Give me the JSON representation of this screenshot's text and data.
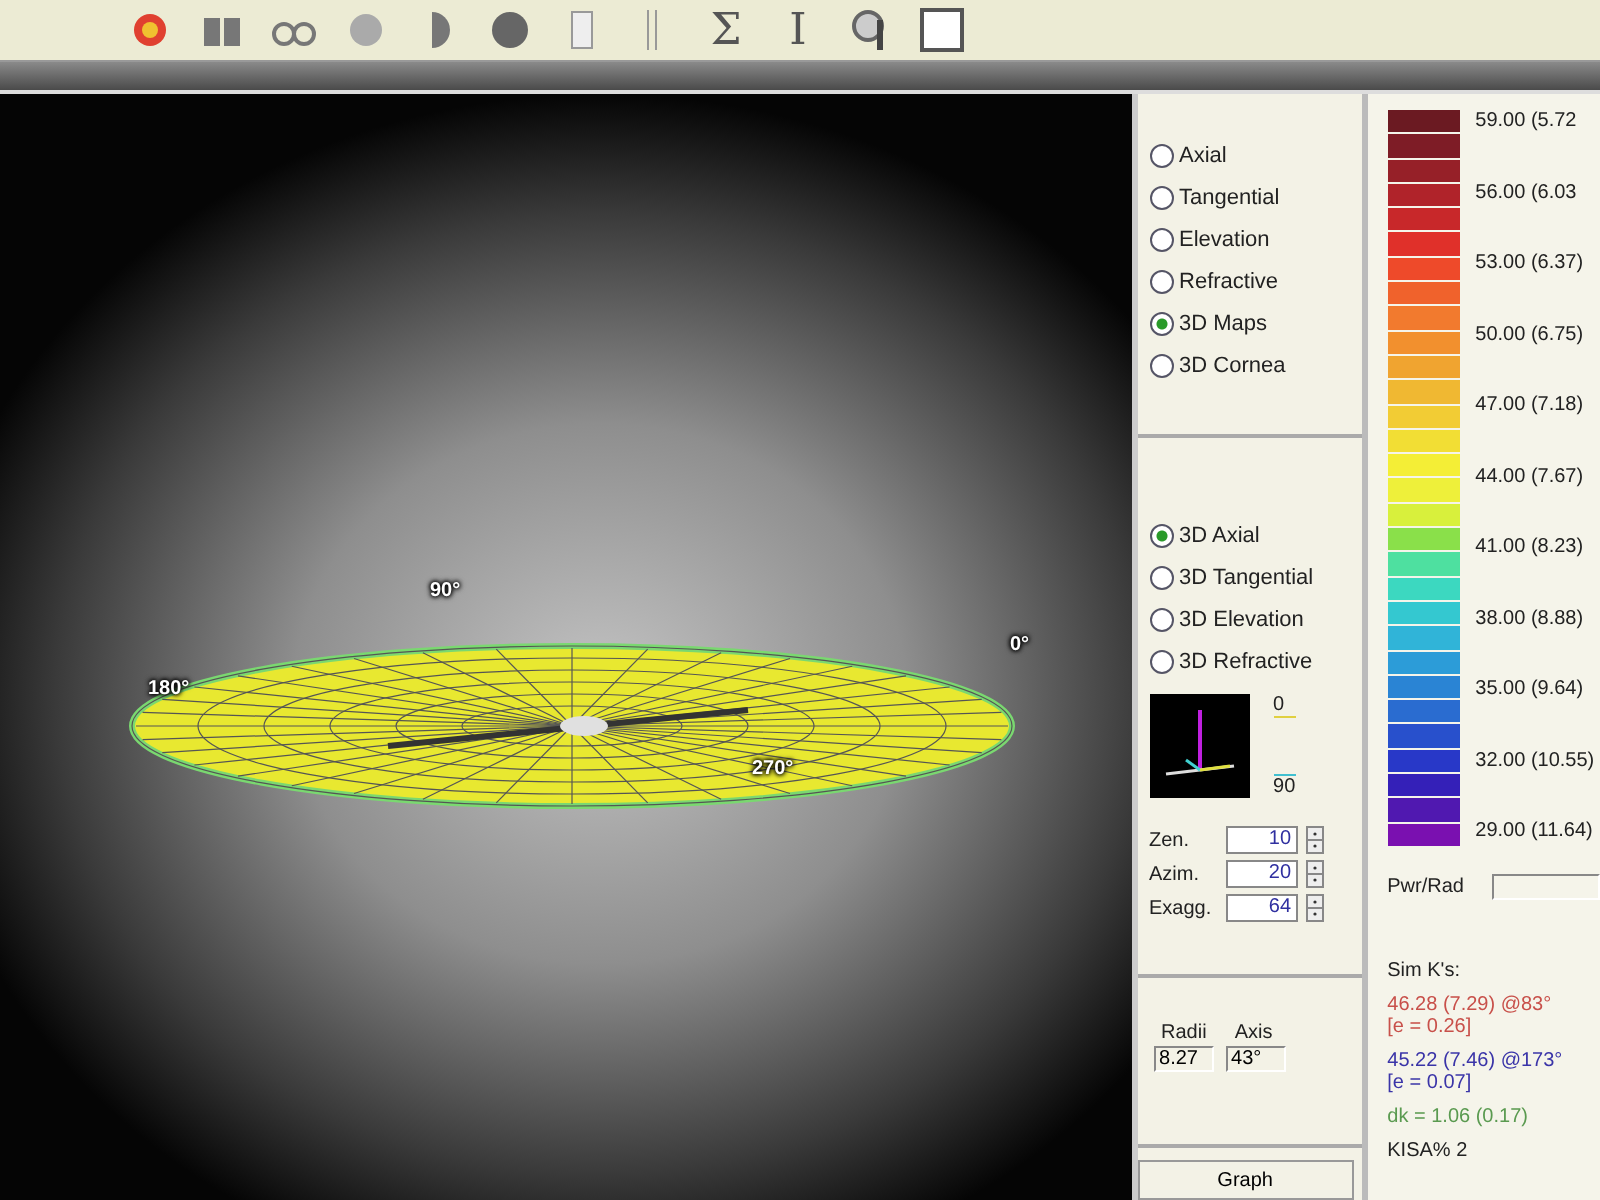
{
  "toolbar": [
    {
      "kind": "heatmap"
    },
    {
      "kind": "bars"
    },
    {
      "kind": "glasses"
    },
    {
      "kind": "sphere"
    },
    {
      "kind": "half-disc"
    },
    {
      "kind": "disc"
    },
    {
      "kind": "page"
    },
    {
      "kind": "lines"
    },
    {
      "kind": "glyph",
      "glyph": "Σ"
    },
    {
      "kind": "glyph",
      "glyph": "I"
    },
    {
      "kind": "magnifier"
    },
    {
      "kind": "window"
    }
  ],
  "viewport": {
    "labels": [
      "90°",
      "180°",
      "0°",
      "270°"
    ]
  },
  "map_types": [
    {
      "label": "Axial",
      "selected": false
    },
    {
      "label": "Tangential",
      "selected": false
    },
    {
      "label": "Elevation",
      "selected": false
    },
    {
      "label": "Refractive",
      "selected": false
    },
    {
      "label": "3D Maps",
      "selected": true
    },
    {
      "label": "3D Cornea",
      "selected": false
    }
  ],
  "map_3d_types": [
    {
      "label": "3D Axial",
      "selected": true
    },
    {
      "label": "3D Tangential",
      "selected": false
    },
    {
      "label": "3D Elevation",
      "selected": false
    },
    {
      "label": "3D Refractive",
      "selected": false
    }
  ],
  "orientation": {
    "top_label": "0",
    "bottom_label": "90"
  },
  "spinners": [
    {
      "label": "Zen.",
      "value": "10"
    },
    {
      "label": "Azim.",
      "value": "20"
    },
    {
      "label": "Exagg.",
      "value": "64"
    }
  ],
  "radii": {
    "radii_label": "Radii",
    "radii_value": "8.27",
    "axis_label": "Axis",
    "axis_value": "43°"
  },
  "graph_button": "Graph",
  "scale": {
    "swatches": [
      {
        "color": "#6b1a22"
      },
      {
        "color": "#7e1c26"
      },
      {
        "color": "#962028"
      },
      {
        "color": "#b0232a"
      },
      {
        "color": "#c8282a"
      },
      {
        "color": "#e0302a"
      },
      {
        "color": "#ee4a2a"
      },
      {
        "color": "#f0622c"
      },
      {
        "color": "#f27a2e"
      },
      {
        "color": "#f2902e"
      },
      {
        "color": "#f0a430"
      },
      {
        "color": "#f0b832"
      },
      {
        "color": "#f2cc34"
      },
      {
        "color": "#f2de34"
      },
      {
        "color": "#f4ee36"
      },
      {
        "color": "#eef03a"
      },
      {
        "color": "#d8f03c"
      },
      {
        "color": "#8ae04a"
      },
      {
        "color": "#4ee0a0"
      },
      {
        "color": "#3cd8c0"
      },
      {
        "color": "#34c8d0"
      },
      {
        "color": "#30b4d8"
      },
      {
        "color": "#2c9cd8"
      },
      {
        "color": "#2a84d4"
      },
      {
        "color": "#2a6cd0"
      },
      {
        "color": "#2850cc"
      },
      {
        "color": "#2838c8"
      },
      {
        "color": "#3420b8"
      },
      {
        "color": "#5018b0"
      },
      {
        "color": "#7a10b0"
      }
    ],
    "labels": [
      "59.00 (5.72",
      "56.00 (6.03",
      "53.00 (6.37)",
      "50.00 (6.75)",
      "47.00 (7.18)",
      "44.00 (7.67)",
      "41.00 (8.23)",
      "38.00 (8.88)",
      "35.00 (9.64)",
      "32.00 (10.55)",
      "29.00 (11.64)"
    ]
  },
  "pwr_rad_label": "Pwr/Rad",
  "sim_k": {
    "title": "Sim K's:",
    "lines": [
      {
        "text": "46.28 (7.29) @83°",
        "ecc": "[e = 0.26]",
        "color": "#c8504a"
      },
      {
        "text": "45.22 (7.46) @173°",
        "ecc": "[e = 0.07]",
        "color": "#3a34a8"
      }
    ],
    "dk": {
      "text": "dk = 1.06 (0.17)",
      "color": "#5a9a50"
    },
    "kisa": "KISA% 2"
  }
}
